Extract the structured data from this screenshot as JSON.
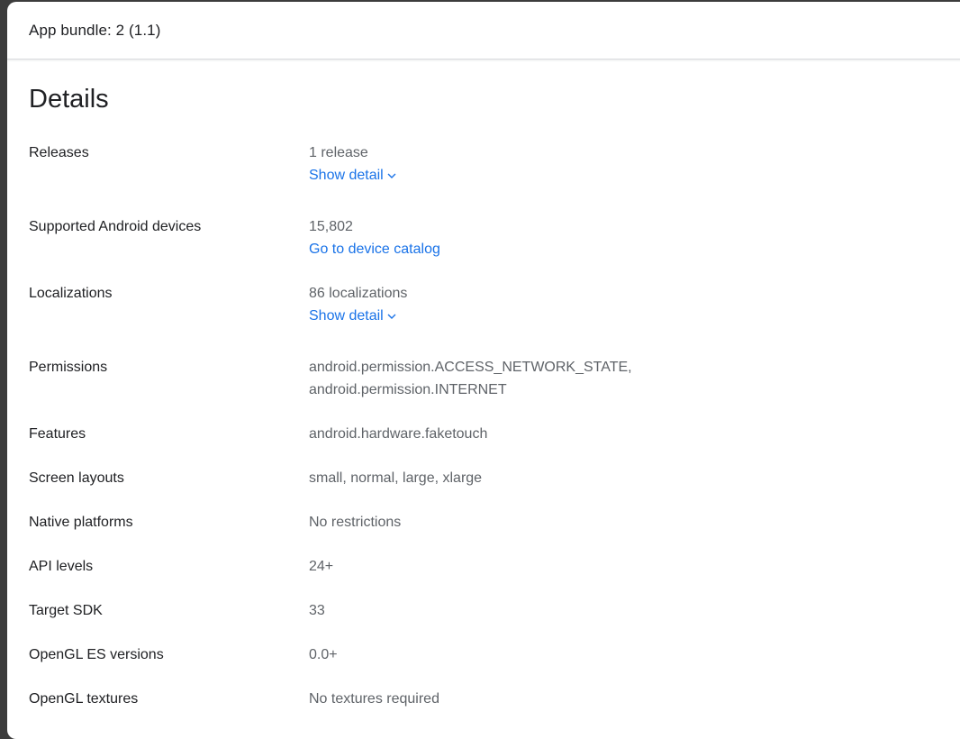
{
  "dialog": {
    "title": "App bundle: 2 (1.1)"
  },
  "details": {
    "heading": "Details",
    "rows": [
      {
        "label": "Releases",
        "value": "1 release",
        "link": "Show detail",
        "link_icon": "chevron-down-icon"
      },
      {
        "label": "Supported Android devices",
        "value": "15,802",
        "link": "Go to device catalog"
      },
      {
        "label": "Localizations",
        "value": "86 localizations",
        "link": "Show detail",
        "link_icon": "chevron-down-icon"
      },
      {
        "label": "Permissions",
        "value": "android.permission.ACCESS_NETWORK_STATE,",
        "value2": "android.permission.INTERNET"
      },
      {
        "label": "Features",
        "value": "android.hardware.faketouch"
      },
      {
        "label": "Screen layouts",
        "value": "small, normal, large, xlarge"
      },
      {
        "label": "Native platforms",
        "value": "No restrictions"
      },
      {
        "label": "API levels",
        "value": "24+"
      },
      {
        "label": "Target SDK",
        "value": "33"
      },
      {
        "label": "OpenGL ES versions",
        "value": "0.0+"
      },
      {
        "label": "OpenGL textures",
        "value": "No textures required"
      }
    ]
  },
  "colors": {
    "link": "#1a73e8",
    "label_text": "#202124",
    "value_text": "#5f6368",
    "background": "#ffffff"
  }
}
